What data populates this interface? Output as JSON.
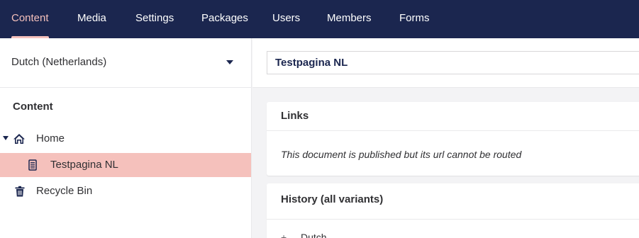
{
  "nav": {
    "items": [
      {
        "label": "Content",
        "active": true
      },
      {
        "label": "Media"
      },
      {
        "label": "Settings"
      },
      {
        "label": "Packages"
      },
      {
        "label": "Users"
      },
      {
        "label": "Members"
      },
      {
        "label": "Forms"
      }
    ]
  },
  "sidebar": {
    "language": "Dutch (Netherlands)",
    "tree_title": "Content",
    "tree": [
      {
        "label": "Home",
        "icon": "home-icon"
      },
      {
        "label": "Testpagina NL",
        "icon": "document-icon",
        "selected": true
      },
      {
        "label": "Recycle Bin",
        "icon": "trash-icon"
      }
    ]
  },
  "editor": {
    "name_value": "Testpagina NL",
    "links": {
      "title": "Links",
      "message": "This document is published but its url cannot be routed"
    },
    "history": {
      "title": "History (all variants)",
      "first_item": "Dutch"
    }
  },
  "colors": {
    "nav_bg": "#1b264f",
    "accent": "#f5c1bc",
    "surface": "#ffffff",
    "background": "#f3f3f5"
  }
}
